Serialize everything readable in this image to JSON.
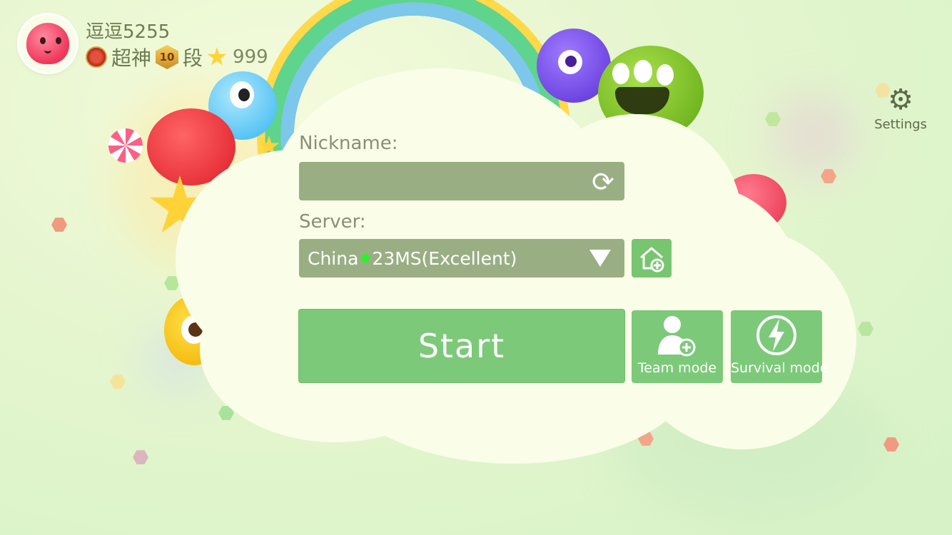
{
  "profile": {
    "username": "逗逗5255",
    "title": "超神",
    "rank_level": "10",
    "rank_suffix": "段",
    "stars": "999"
  },
  "settings": {
    "label": "Settings",
    "icon": "gear-icon"
  },
  "form": {
    "nickname_label": "Nickname:",
    "nickname_value": "",
    "server_label": "Server:",
    "server_name": "China",
    "server_ping": "23MS(Excellent)",
    "server_status_color": "#2ef12e"
  },
  "buttons": {
    "start": "Start",
    "team_mode": "Team mode",
    "survival_mode": "Survival mode"
  },
  "colors": {
    "button_green": "#7cc97a",
    "input_green": "#9aae84",
    "cloud": "#fafde8"
  }
}
